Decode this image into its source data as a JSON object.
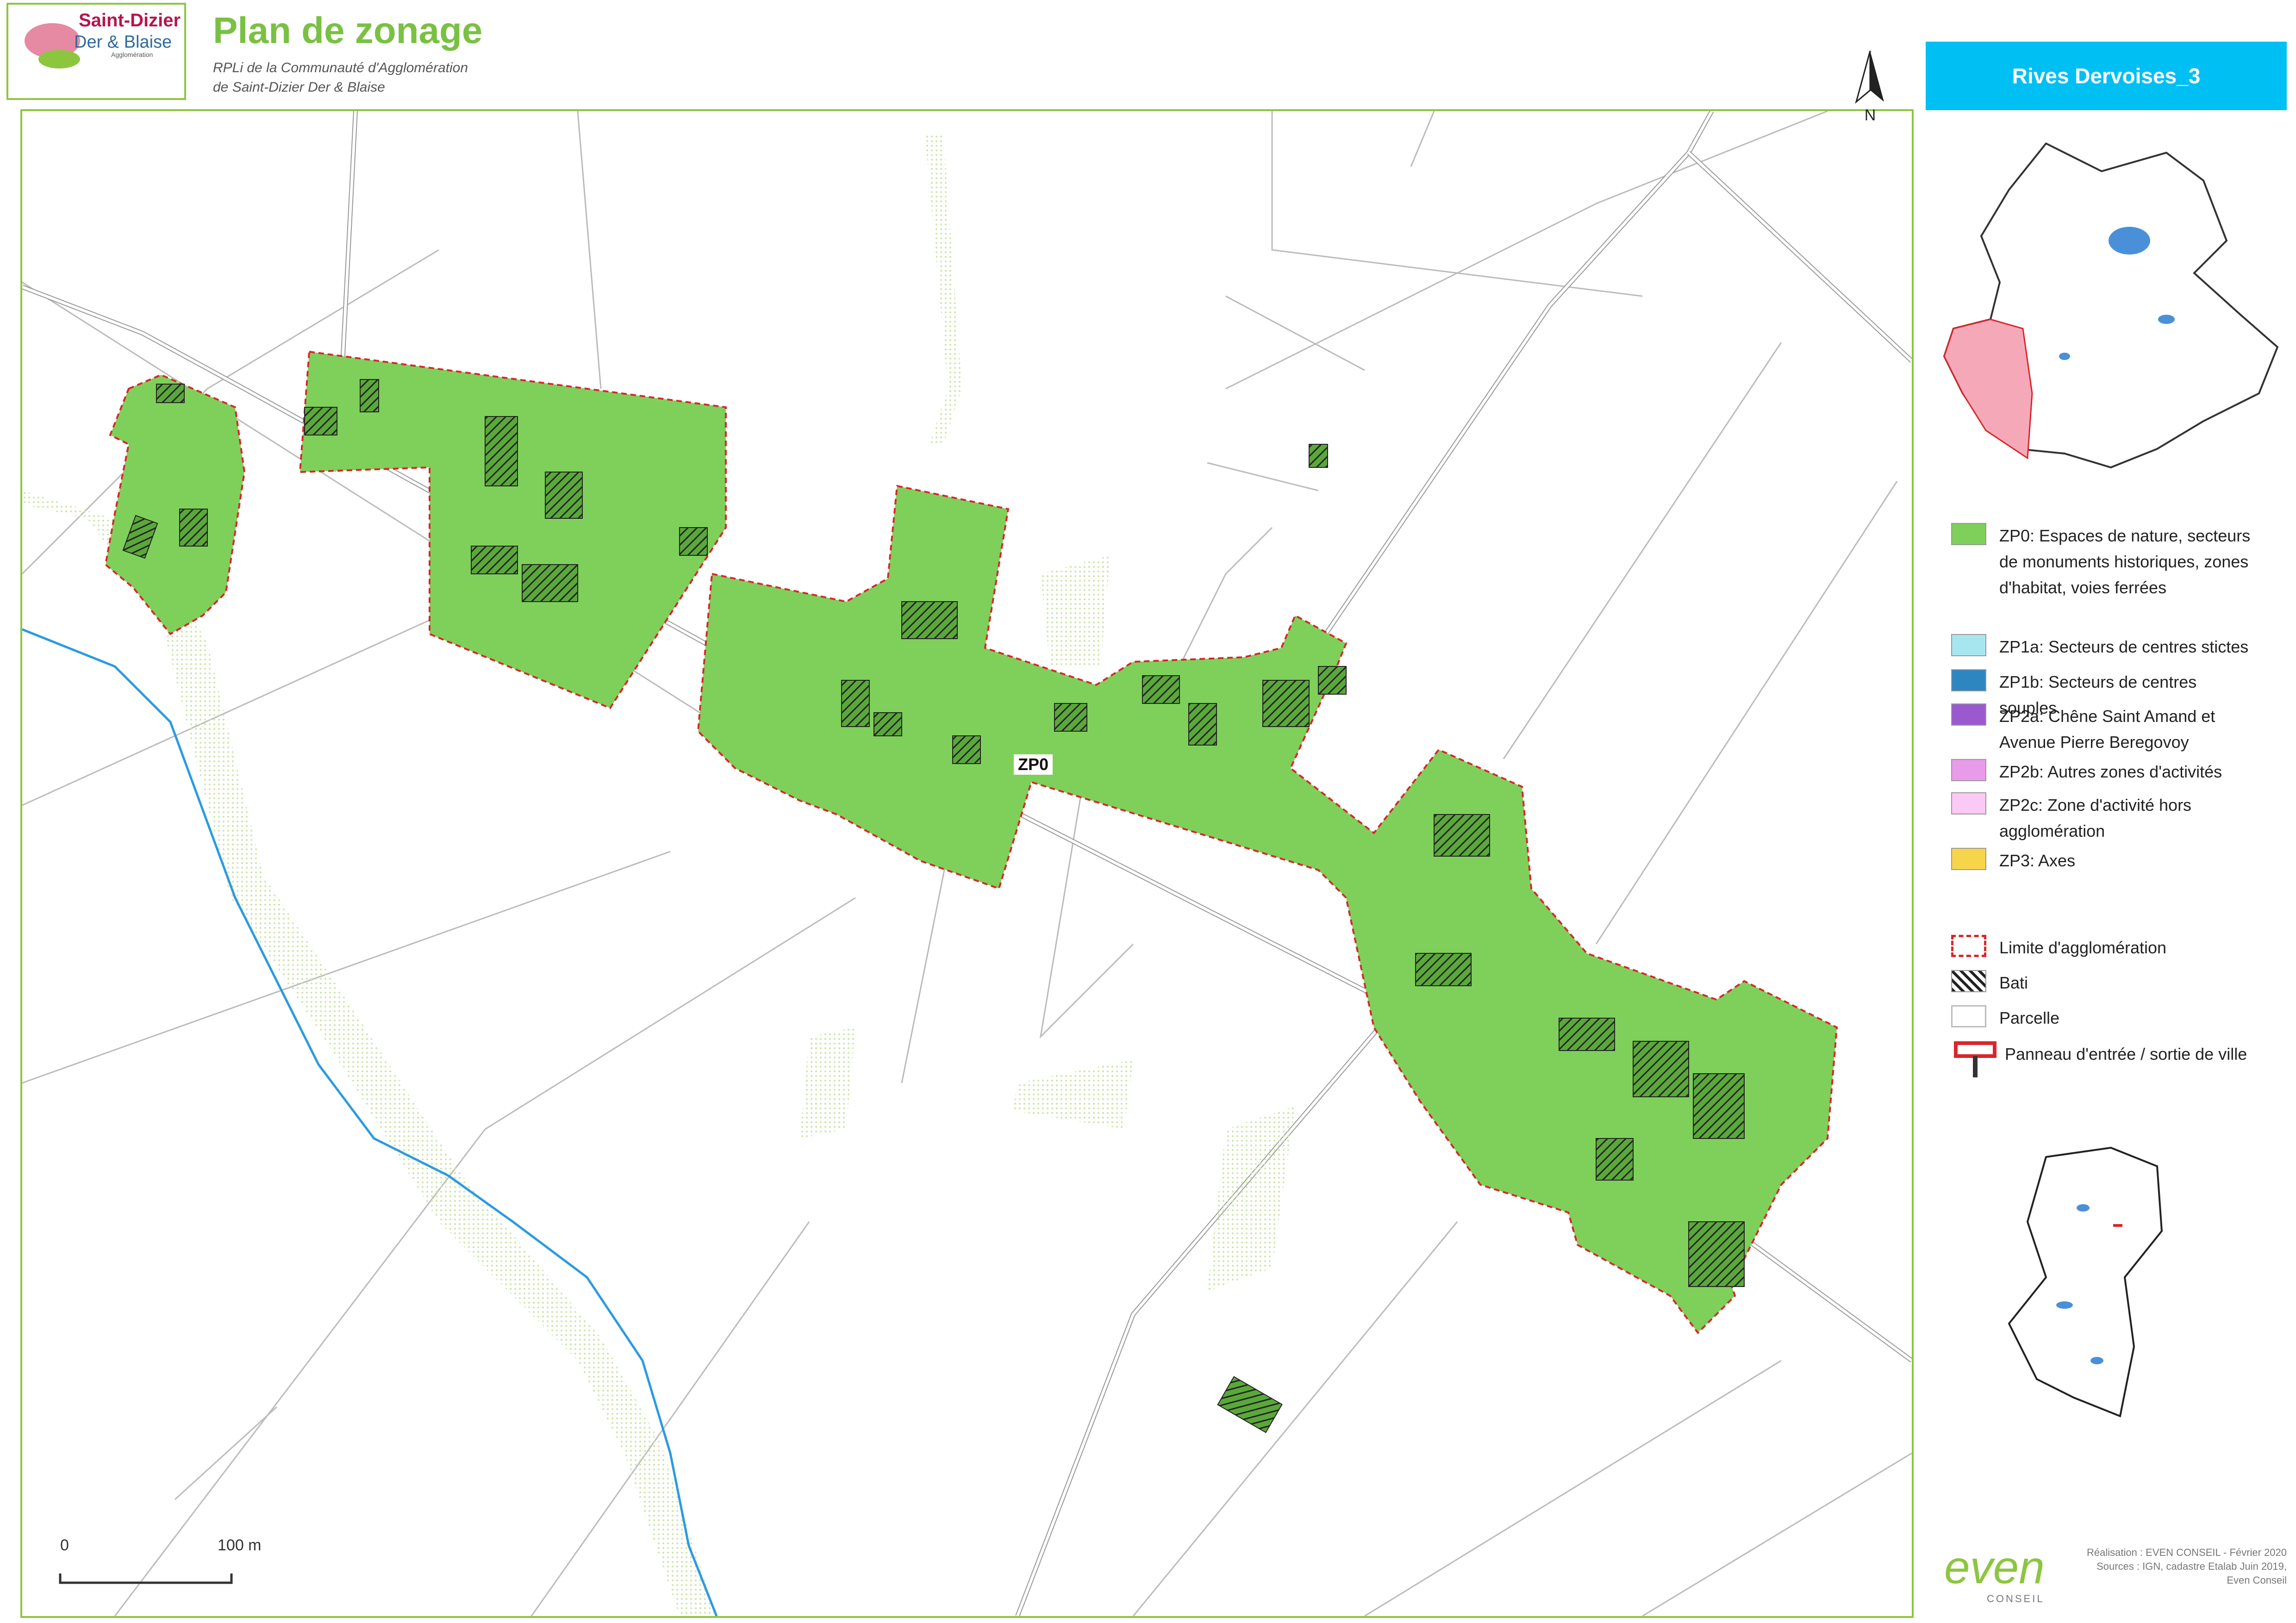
{
  "header": {
    "logo_line1": "Saint-Dizier",
    "logo_line2": "Der & Blaise",
    "logo_line3": "Agglomération",
    "title": "Plan de zonage",
    "subtitle_line1": "RPLi de la Communauté d'Agglomération",
    "subtitle_line2": "de Saint-Dizier Der & Blaise"
  },
  "map": {
    "zone_label": "ZP0",
    "north_label": "N",
    "scale_start": "0",
    "scale_end": "100 m",
    "colors": {
      "zone_fill": "#7ed05a",
      "agglo_limit": "#d9262c",
      "river": "#2b9be0",
      "parcel": "#bbbbbb",
      "frame": "#8cc63f"
    }
  },
  "sidebar": {
    "commune": "Rives Dervoises_3",
    "legend_zones": [
      {
        "label": "ZP0: Espaces de nature, secteurs de monuments historiques, zones d'habitat, voies ferrées",
        "color": "#7ed05a"
      },
      {
        "label": "ZP1a: Secteurs de centres stictes",
        "color": "#a8e6ef"
      },
      {
        "label": "ZP1b: Secteurs de centres souples",
        "color": "#2e86c1"
      },
      {
        "label": "ZP2a: Chêne Saint Amand et Avenue Pierre Beregovoy",
        "color": "#9b59d0"
      },
      {
        "label": "ZP2b: Autres zones d'activités",
        "color": "#e89be8"
      },
      {
        "label": "ZP2c: Zone d'activité hors agglomération",
        "color": "#fbc9f5"
      },
      {
        "label": "ZP3: Axes",
        "color": "#f7d54a"
      }
    ],
    "legend_other": [
      {
        "label": "Limite d'agglomération",
        "icon": "dashed-red-box-icon"
      },
      {
        "label": "Bati",
        "icon": "hatched-box-icon"
      },
      {
        "label": "Parcelle",
        "icon": "empty-box-icon"
      },
      {
        "label": "Panneau d'entrée / sortie de ville",
        "icon": "town-sign-icon"
      }
    ]
  },
  "footer": {
    "credits_line1": "Réalisation : EVEN CONSEIL - Février 2020",
    "credits_line2": "Sources : IGN, cadastre Etalab Juin 2019,",
    "credits_line3": "Even Conseil",
    "even_logo": "even",
    "even_sub": "CONSEIL"
  }
}
